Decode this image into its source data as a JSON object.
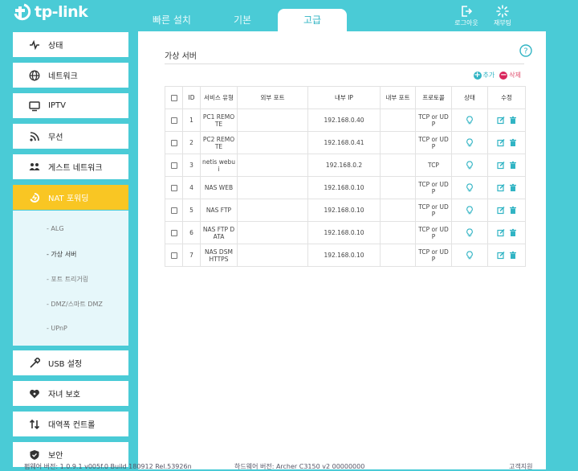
{
  "brand": {
    "name": "tp-link"
  },
  "tabs": [
    {
      "label": "빠른 설치",
      "active": false
    },
    {
      "label": "기본",
      "active": false
    },
    {
      "label": "고급",
      "active": true
    }
  ],
  "header_buttons": {
    "logout": {
      "label": "로그아웃",
      "icon": "logout-icon"
    },
    "reboot": {
      "label": "재부팅",
      "icon": "reboot-icon"
    }
  },
  "sidebar": {
    "items": [
      {
        "label": "상태",
        "icon": "pulse-icon"
      },
      {
        "label": "네트워크",
        "icon": "globe-icon"
      },
      {
        "label": "IPTV",
        "icon": "tv-icon"
      },
      {
        "label": "무선",
        "icon": "wifi-icon"
      },
      {
        "label": "게스트 네트워크",
        "icon": "guest-icon"
      },
      {
        "label": "NAT 포워딩",
        "icon": "nat-icon",
        "active": true
      },
      {
        "label": "USB 설정",
        "icon": "usb-icon"
      },
      {
        "label": "자녀 보호",
        "icon": "heart-icon"
      },
      {
        "label": "대역폭 컨트롤",
        "icon": "updown-icon"
      },
      {
        "label": "보안",
        "icon": "shield-icon"
      }
    ],
    "sub_items": [
      {
        "label": "- ALG"
      },
      {
        "label": "- 가상 서버",
        "active": true
      },
      {
        "label": "- 포트 트리거링"
      },
      {
        "label": "- DMZ/스마트 DMZ"
      },
      {
        "label": "- UPnP"
      }
    ]
  },
  "section": {
    "title": "가상 서버"
  },
  "actions": {
    "add_label": "추가",
    "delete_label": "삭제"
  },
  "table": {
    "headers": [
      "",
      "ID",
      "서비스 유형",
      "외부 포트",
      "내부 IP",
      "내부 포트",
      "프로토콜",
      "상태",
      "수정"
    ],
    "rows": [
      {
        "id": "1",
        "service": "PC1 REMOTE",
        "external_port": "",
        "internal_ip": "192.168.0.40",
        "internal_port": "",
        "protocol": "TCP or UDP"
      },
      {
        "id": "2",
        "service": "PC2 REMOTE",
        "external_port": "",
        "internal_ip": "192.168.0.41",
        "internal_port": "",
        "protocol": "TCP or UDP"
      },
      {
        "id": "3",
        "service": "netis webui",
        "external_port": "",
        "internal_ip": "192.168.0.2",
        "internal_port": "",
        "protocol": "TCP"
      },
      {
        "id": "4",
        "service": "NAS WEB",
        "external_port": "",
        "internal_ip": "192.168.0.10",
        "internal_port": "",
        "protocol": "TCP or UDP"
      },
      {
        "id": "5",
        "service": "NAS FTP",
        "external_port": "",
        "internal_ip": "192.168.0.10",
        "internal_port": "",
        "protocol": "TCP or UDP"
      },
      {
        "id": "6",
        "service": "NAS FTP DATA",
        "external_port": "",
        "internal_ip": "192.168.0.10",
        "internal_port": "",
        "protocol": "TCP or UDP"
      },
      {
        "id": "7",
        "service": "NAS DSM HTTPS",
        "external_port": "",
        "internal_ip": "192.168.0.10",
        "internal_port": "",
        "protocol": "TCP or UDP"
      }
    ]
  },
  "footer": {
    "firmware": "펌웨어 버전: 1.0.9.1 v005f.0 Build 180912 Rel.53926n",
    "hardware": "하드웨어 버전: Archer C3150 v2 00000000",
    "support": "고객지원"
  },
  "colors": {
    "background": "#4acbd6",
    "accent": "#31b4c4",
    "active_nav": "#f9c623",
    "delete": "#d9255c"
  }
}
